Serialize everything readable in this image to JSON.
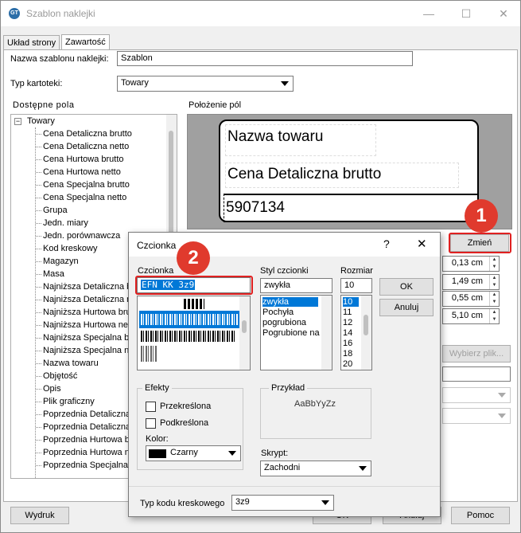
{
  "window": {
    "title": "Szablon naklejki",
    "icon_text": "GT"
  },
  "tabs": [
    {
      "label": "Układ strony"
    },
    {
      "label": "Zawartość"
    }
  ],
  "form": {
    "template_name_label": "Nazwa szablonu naklejki:",
    "template_name_value": "Szablon",
    "card_type_label": "Typ kartoteki:",
    "card_type_value": "Towary"
  },
  "available_fields": {
    "title": "Dostępne pola",
    "root": "Towary",
    "items": [
      "Cena Detaliczna brutto",
      "Cena Detaliczna netto",
      "Cena Hurtowa brutto",
      "Cena Hurtowa netto",
      "Cena Specjalna brutto",
      "Cena Specjalna netto",
      "Grupa",
      "Jedn. miary",
      "Jedn. porównawcza",
      "Kod kreskowy",
      "Magazyn",
      "Masa",
      "Najniższa Detaliczna br",
      "Najniższa Detaliczna ne",
      "Najniższa Hurtowa bru",
      "Najniższa Hurtowa net",
      "Najniższa Specjalna br",
      "Najniższa Specjalna ne",
      "Nazwa towaru",
      "Objętość",
      "Opis",
      "Plik graficzny",
      "Poprzednia Detaliczna",
      "Poprzednia Detaliczna",
      "Poprzednia Hurtowa b",
      "Poprzednia Hurtowa n",
      "Poprzednia Specjalna b"
    ]
  },
  "field_positions": {
    "title": "Położenie pól",
    "label_fields": [
      "Nazwa towaru",
      "Cena Detaliczna brutto",
      "5907134"
    ]
  },
  "right_panel": {
    "change_button": "Zmień",
    "spin_values": [
      "0,13 cm",
      "1,49 cm",
      "0,55 cm",
      "5,10 cm"
    ],
    "choose_file_button": "Wybierz plik..."
  },
  "annotations": {
    "marker1": "1",
    "marker2": "2"
  },
  "font_dialog": {
    "title": "Czcionka",
    "help": "?",
    "font_label": "Czcionka",
    "font_value": "EFN KK 3z9",
    "style_label": "Styl czcionki",
    "style_value": "zwykła",
    "style_options": [
      "zwykła",
      "Pochyła",
      "pogrubiona",
      "Pogrubione na"
    ],
    "size_label": "Rozmiar",
    "size_value": "10",
    "size_options": [
      "10",
      "11",
      "12",
      "14",
      "16",
      "18",
      "20"
    ],
    "ok_button": "OK",
    "cancel_button": "Anuluj",
    "effects_label": "Efekty",
    "strikeout_label": "Przekreślona",
    "underline_label": "Podkreślona",
    "color_label": "Kolor:",
    "color_value": "Czarny",
    "sample_label": "Przykład",
    "sample_text": "AaBbYyZz",
    "script_label": "Skrypt:",
    "script_value": "Zachodni",
    "barcode_type_label": "Typ kodu kreskowego",
    "barcode_type_value": "3z9"
  },
  "bottom": {
    "print_button": "Wydruk",
    "ok_button": "OK",
    "cancel_button": "Anuluj",
    "help_button": "Pomoc"
  },
  "colors": {
    "accent": "#0078d7",
    "marker": "#e03a2d"
  }
}
